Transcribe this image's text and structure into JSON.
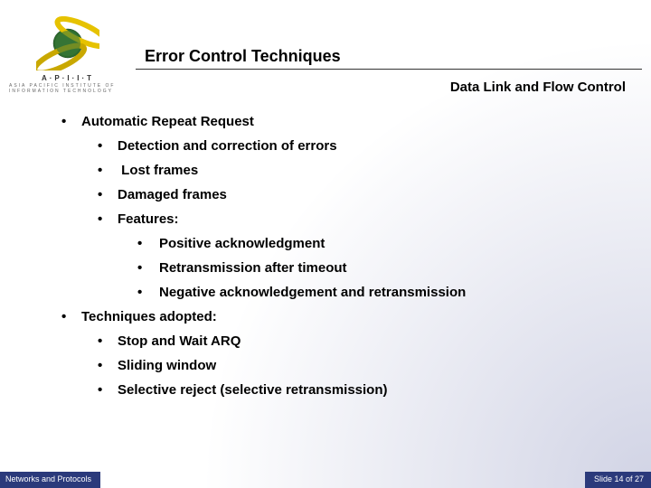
{
  "logo": {
    "text": "A·P·I·I·T",
    "sub": "ASIA PACIFIC INSTITUTE OF INFORMATION TECHNOLOGY"
  },
  "title": "Error Control Techniques",
  "subtitle": "Data Link and Flow Control",
  "bullets": {
    "l0_0": "Automatic Repeat Request",
    "l1_0": "Detection and correction of errors",
    "l1_1": " Lost frames",
    "l1_2": "Damaged frames",
    "l1_3": "Features:",
    "l2_0": "Positive acknowledgment",
    "l2_1": "Retransmission after timeout",
    "l2_2": "Negative acknowledgement and retransmission",
    "l0_1": "Techniques adopted:",
    "l1_4": "Stop and Wait ARQ",
    "l1_5": "Sliding window",
    "l1_6": "Selective reject (selective retransmission)"
  },
  "footer": {
    "left": "Networks and Protocols",
    "right": "Slide 14 of 27"
  }
}
